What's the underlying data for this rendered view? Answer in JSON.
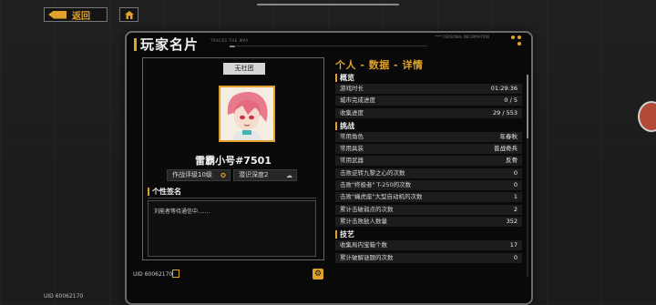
{
  "nav": {
    "back_label": "返回"
  },
  "uid_corner": "UID 60062170",
  "panel": {
    "title": "玩家名片",
    "subtitle": "TRACES THE WAY",
    "code": "**** PERSONAL INFORMATION"
  },
  "profile": {
    "guild": "无社团",
    "nickname": "雷霸小号#7501",
    "combat_rating": "作战评级10级",
    "insight_depth": "潜识深度2",
    "signature_title": "个性签名",
    "signature_text": "刘能者等待通信中.......",
    "uid": "UID 60062170"
  },
  "details": {
    "title": "个人 - 数据 - 详情",
    "sections": [
      {
        "name": "概览",
        "rows": [
          {
            "label": "游戏时长",
            "value": "01:29:36"
          },
          {
            "label": "城市完成进度",
            "value": "0 / 5"
          },
          {
            "label": "收集进度",
            "value": "29 / 553"
          }
        ]
      },
      {
        "name": "挑战",
        "rows": [
          {
            "label": "常用角色",
            "value": "年春秋"
          },
          {
            "label": "常用具装",
            "value": "普战奇兵"
          },
          {
            "label": "常用武器",
            "value": "反骨"
          },
          {
            "label": "击败逆转九黎之心的次数",
            "value": "0"
          },
          {
            "label": "击败\"终极者\" T-250的次数",
            "value": "0"
          },
          {
            "label": "击败\"蝇虎座\"大型自动机的次数",
            "value": "1"
          },
          {
            "label": "累计击破弱点的次数",
            "value": "2"
          },
          {
            "label": "累计击败敌人数量",
            "value": "352"
          }
        ]
      },
      {
        "name": "技艺",
        "rows": [
          {
            "label": "收集局内宝箱个数",
            "value": "17"
          },
          {
            "label": "累计破解谜题的次数",
            "value": "0"
          }
        ]
      }
    ]
  },
  "colors": {
    "accent": "#e0a22a",
    "panel_bg": "#090909",
    "row_bg": "#1c1c1c"
  }
}
